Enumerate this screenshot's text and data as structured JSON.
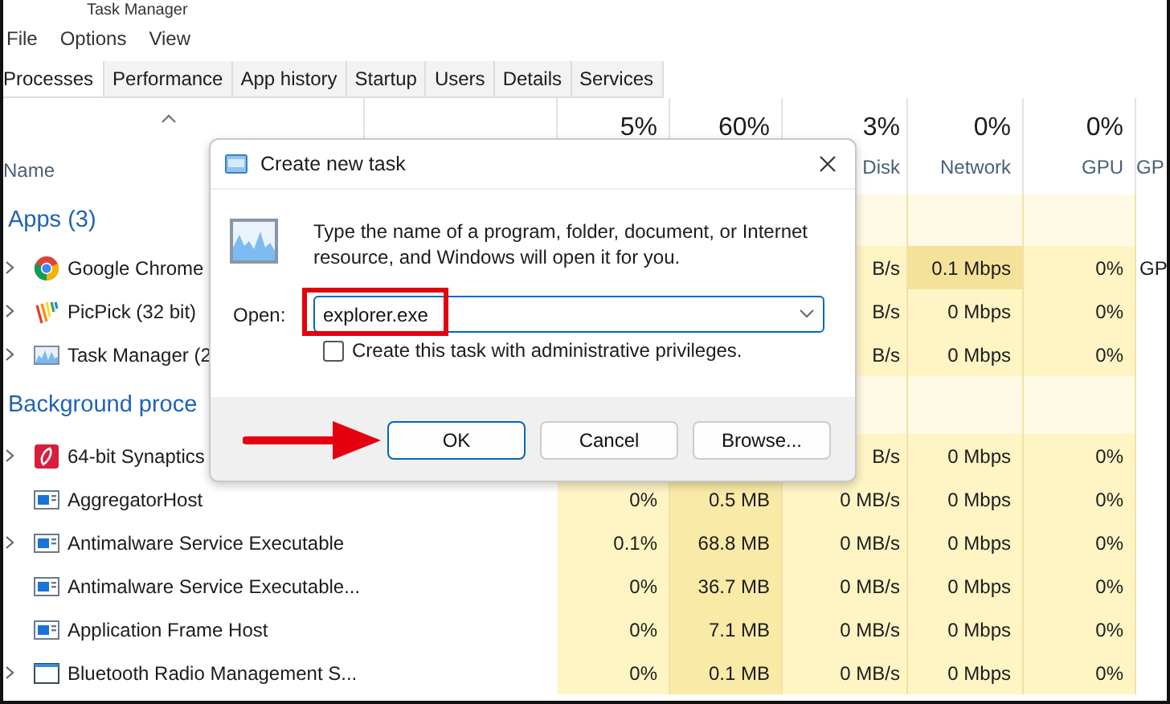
{
  "window": {
    "title": "Task Manager"
  },
  "menu": [
    "File",
    "Options",
    "View"
  ],
  "tabs": [
    {
      "label": "Processes",
      "selected": true
    },
    {
      "label": "Performance",
      "selected": false
    },
    {
      "label": "App history",
      "selected": false
    },
    {
      "label": "Startup",
      "selected": false
    },
    {
      "label": "Users",
      "selected": false
    },
    {
      "label": "Details",
      "selected": false
    },
    {
      "label": "Services",
      "selected": false
    }
  ],
  "columns": [
    {
      "label": "Name"
    },
    {
      "percent": "5%"
    },
    {
      "percent": "60%"
    },
    {
      "percent": "3%",
      "label": "Disk"
    },
    {
      "percent": "0%",
      "label": "Network"
    },
    {
      "percent": "0%",
      "label": "GPU"
    },
    {
      "label": "GP"
    }
  ],
  "rows": [
    {
      "kind": "group",
      "name": "Apps (3)"
    },
    {
      "kind": "process",
      "name": "Google Chrome",
      "expandable": true,
      "network_busy": true,
      "cells": {
        "disk": "B/s",
        "network": "0.1 Mbps",
        "gpu": "0%",
        "gpu_engine": "GP"
      }
    },
    {
      "kind": "process",
      "name": "PicPick (32 bit)",
      "expandable": true,
      "network_busy": false,
      "cells": {
        "disk": "B/s",
        "network": "0 Mbps",
        "gpu": "0%"
      }
    },
    {
      "kind": "process",
      "name": "Task Manager (2",
      "expandable": true,
      "network_busy": false,
      "cells": {
        "disk": "B/s",
        "network": "0 Mbps",
        "gpu": "0%"
      }
    },
    {
      "kind": "group",
      "name": "Background proce"
    },
    {
      "kind": "process",
      "name": "64-bit Synaptics",
      "expandable": true,
      "network_busy": false,
      "cells": {
        "disk": "B/s",
        "network": "0 Mbps",
        "gpu": "0%"
      }
    },
    {
      "kind": "process",
      "name": "AggregatorHost",
      "expandable": false,
      "network_busy": false,
      "cells": {
        "cpu": "0%",
        "memory": "0.5 MB",
        "disk": "0 MB/s",
        "network": "0 Mbps",
        "gpu": "0%"
      }
    },
    {
      "kind": "process",
      "name": "Antimalware Service Executable",
      "expandable": true,
      "network_busy": false,
      "cells": {
        "cpu": "0.1%",
        "memory": "68.8 MB",
        "disk": "0 MB/s",
        "network": "0 Mbps",
        "gpu": "0%"
      }
    },
    {
      "kind": "process",
      "name": "Antimalware Service Executable...",
      "expandable": false,
      "network_busy": false,
      "cells": {
        "cpu": "0%",
        "memory": "36.7 MB",
        "disk": "0 MB/s",
        "network": "0 Mbps",
        "gpu": "0%"
      }
    },
    {
      "kind": "process",
      "name": "Application Frame Host",
      "expandable": false,
      "network_busy": false,
      "cells": {
        "cpu": "0%",
        "memory": "7.1 MB",
        "disk": "0 MB/s",
        "network": "0 Mbps",
        "gpu": "0%"
      }
    },
    {
      "kind": "process",
      "name": "Bluetooth Radio Management S...",
      "expandable": true,
      "network_busy": false,
      "cells": {
        "cpu": "0%",
        "memory": "0.1 MB",
        "disk": "0 MB/s",
        "network": "0 Mbps",
        "gpu": "0%"
      }
    }
  ],
  "dialog": {
    "title": "Create new task",
    "message": "Type the name of a program, folder, document, or Internet resource, and Windows will open it for you.",
    "open_label": "Open:",
    "open_value": "explorer.exe",
    "checkbox": {
      "label": "Create this task with administrative privileges.",
      "checked": false
    },
    "buttons": [
      {
        "label": "OK",
        "default": true
      },
      {
        "label": "Cancel",
        "default": false
      },
      {
        "label": "Browse...",
        "default": false
      }
    ]
  }
}
